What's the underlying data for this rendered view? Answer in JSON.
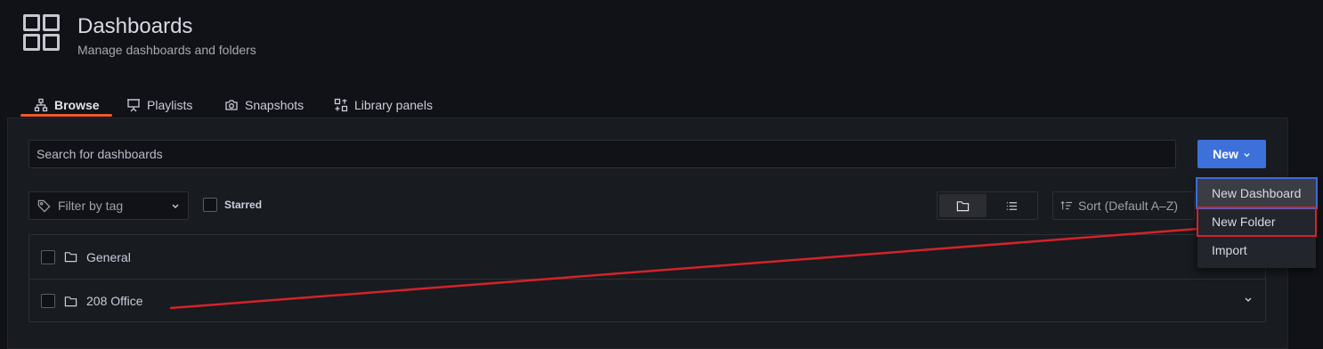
{
  "header": {
    "title": "Dashboards",
    "subtitle": "Manage dashboards and folders"
  },
  "tabs": [
    {
      "label": "Browse",
      "icon": "sitemap-icon",
      "active": true
    },
    {
      "label": "Playlists",
      "icon": "presentation-icon"
    },
    {
      "label": "Snapshots",
      "icon": "camera-icon"
    },
    {
      "label": "Library panels",
      "icon": "library-panels-icon"
    }
  ],
  "search": {
    "placeholder": "Search for dashboards",
    "value": ""
  },
  "new_button": {
    "label": "New"
  },
  "filter": {
    "placeholder": "Filter by tag"
  },
  "starred": {
    "label": "Starred"
  },
  "sort": {
    "label": "Sort (Default A–Z)"
  },
  "folders": [
    {
      "name": "General"
    },
    {
      "name": "208 Office"
    }
  ],
  "new_menu": {
    "items": [
      {
        "label": "New Dashboard"
      },
      {
        "label": "New Folder"
      },
      {
        "label": "Import"
      }
    ]
  },
  "colors": {
    "accent": "#3d71d9",
    "tab_underline": "#f05a28",
    "annotation": "#d3232a",
    "background": "#111217",
    "panel": "#181b1f"
  }
}
